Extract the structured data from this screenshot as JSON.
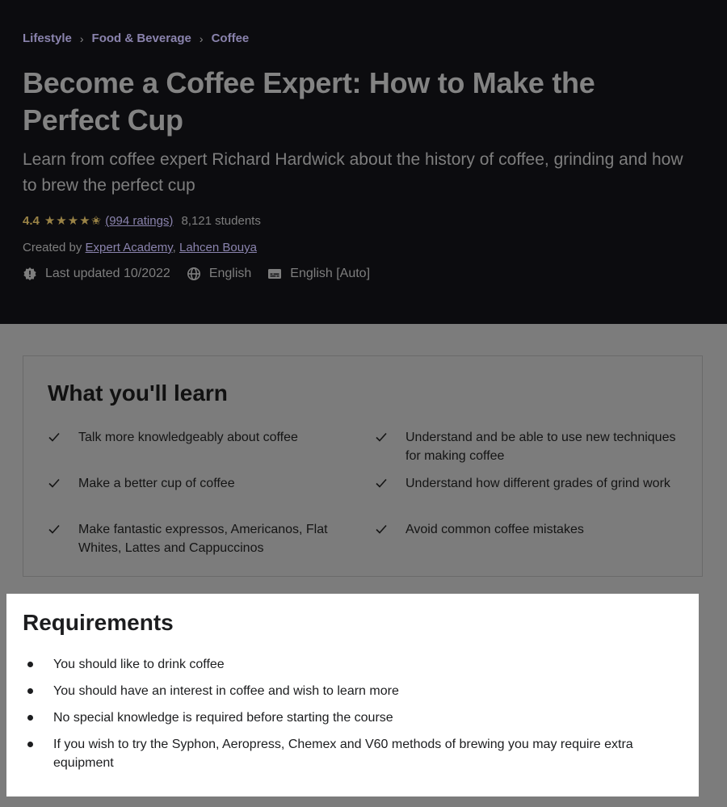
{
  "breadcrumb": {
    "items": [
      "Lifestyle",
      "Food & Beverage",
      "Coffee"
    ],
    "separator": "›"
  },
  "course": {
    "title": "Become a Coffee Expert: How to Make the Perfect Cup",
    "subtitle": "Learn from coffee expert Richard Hardwick about the history of coffee, grinding and how to brew the perfect cup",
    "rating": "4.4",
    "rating_value": 4.4,
    "stars": "★★★★✬",
    "ratings_count": "(994 ratings)",
    "students": "8,121 students",
    "created_by_label": "Created by",
    "instructors": [
      "Expert Academy",
      "Lahcen Bouya"
    ],
    "last_updated": "Last updated 10/2022",
    "language": "English",
    "captions": "English [Auto]"
  },
  "learn": {
    "title": "What you'll learn",
    "items": [
      "Talk more knowledgeably about coffee",
      "Understand and be able to use new techniques for making coffee",
      "Make a better cup of coffee",
      "Understand how different grades of grind work",
      "Make fantastic expressos, Americanos, Flat Whites, Lattes and Cappuccinos",
      "Avoid common coffee mistakes"
    ]
  },
  "requirements": {
    "title": "Requirements",
    "items": [
      "You should like to drink coffee",
      "You should have an interest in coffee and wish to learn more",
      "No special knowledge is required before starting the course",
      "If you wish to try the Syphon, Aeropress, Chemex and V60 methods of brewing you may require extra equipment"
    ]
  },
  "colors": {
    "header_bg": "#0c0c0f",
    "dim_overlay": "#7c7c7c",
    "link": "#8a83ad",
    "star": "#9a8346",
    "panel_bg": "#ffffff"
  }
}
